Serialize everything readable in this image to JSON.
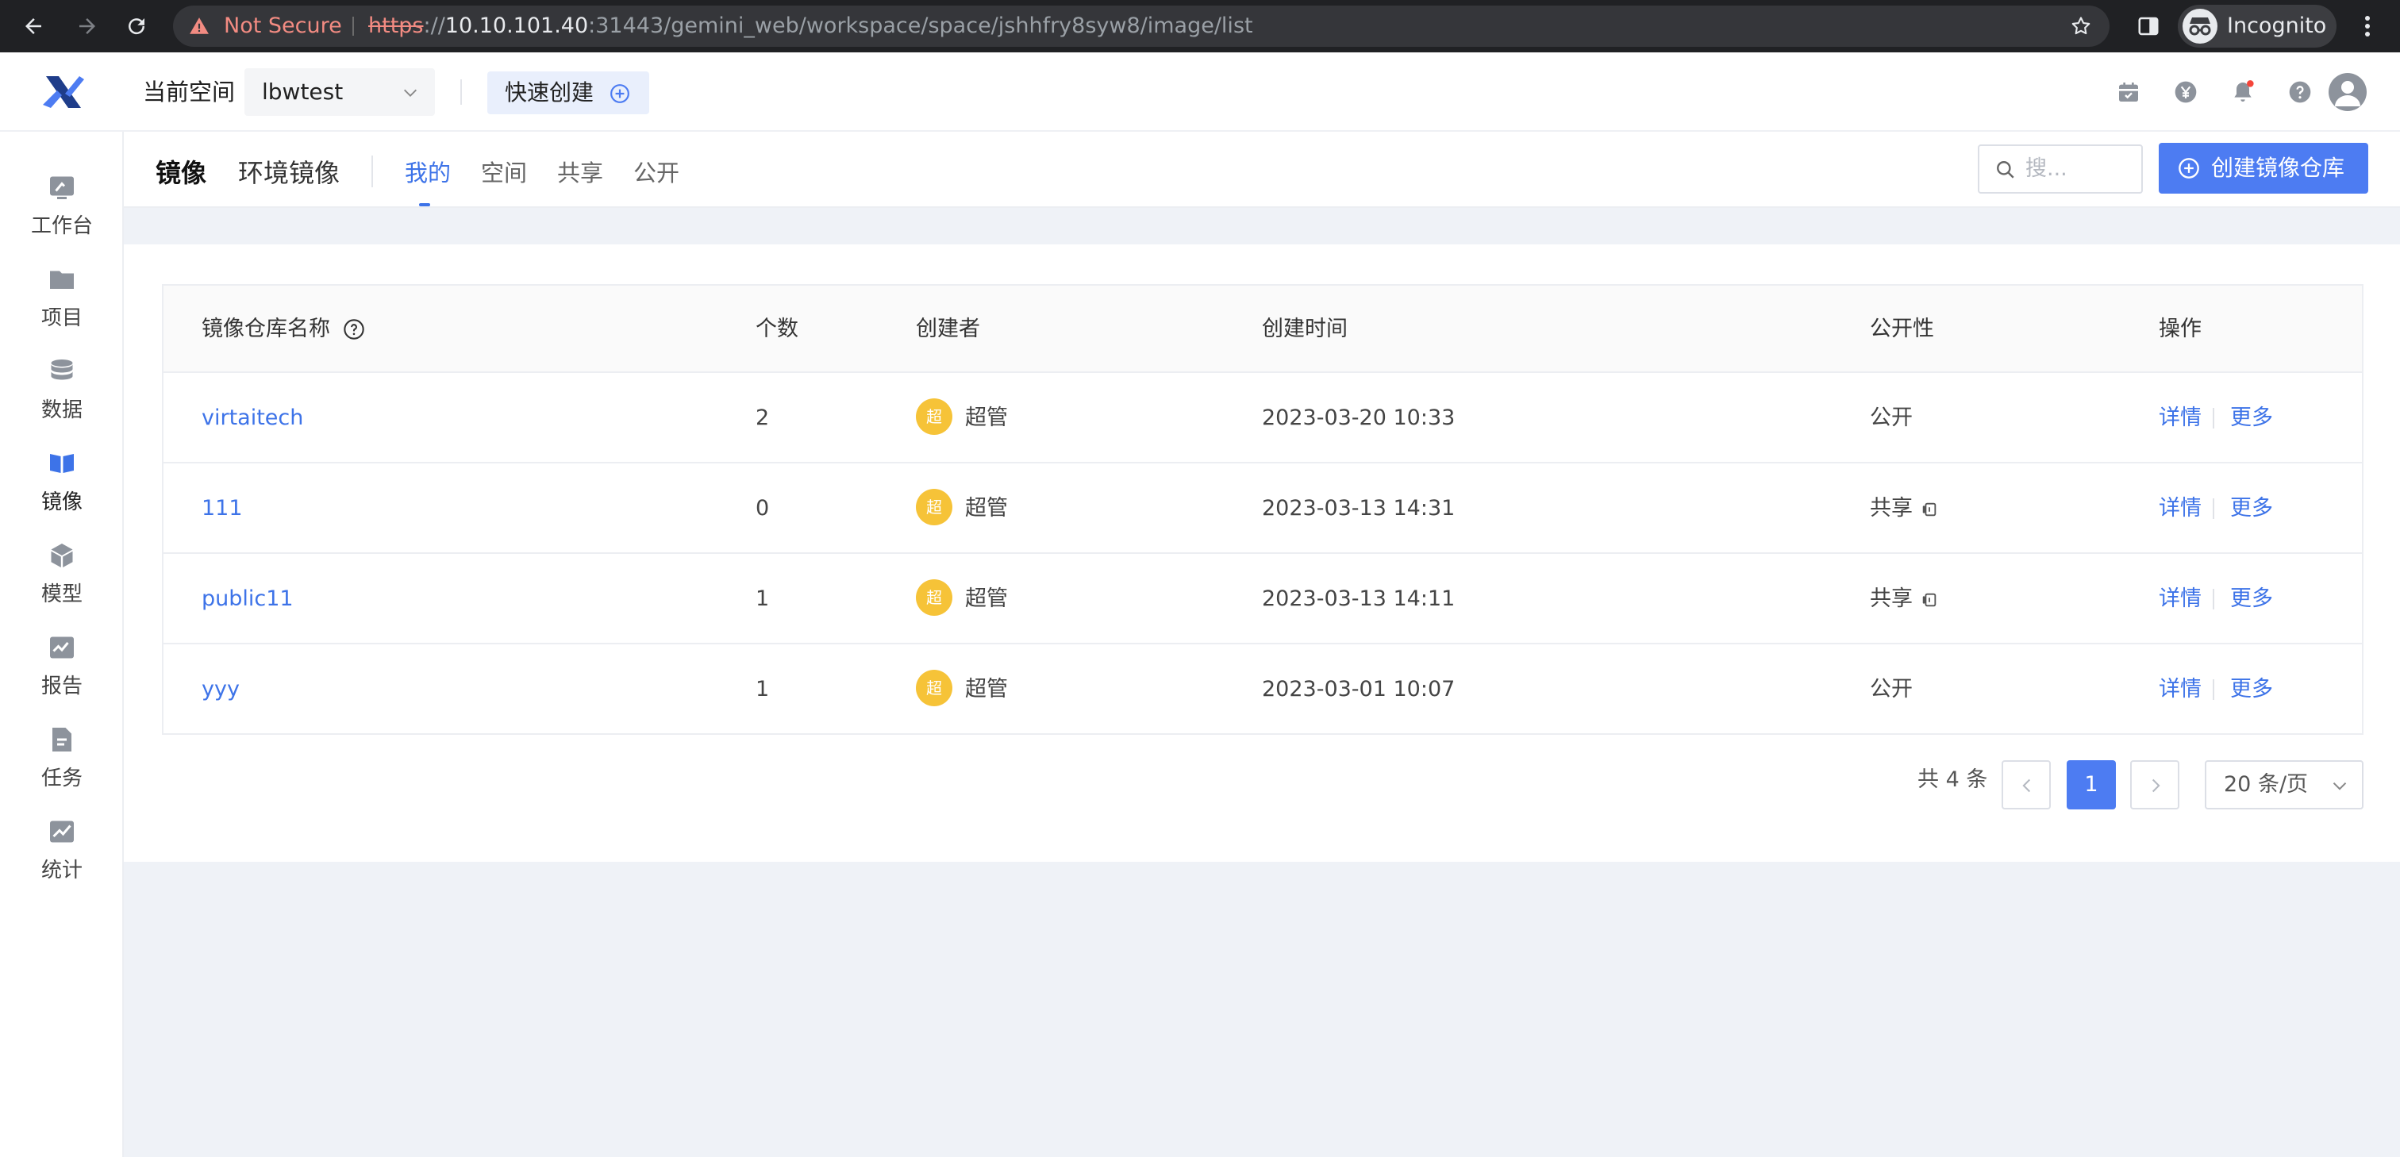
{
  "browser": {
    "security_label": "Not Secure",
    "url_scheme": "https",
    "url_host": "10.10.101.40",
    "url_rest": ":31443/gemini_web/workspace/space/jshhfry8syw8/image/list",
    "profile_label": "Incognito"
  },
  "header": {
    "space_label": "当前空间",
    "space_value": "lbwtest",
    "quick_create_label": "快速创建"
  },
  "sidebar": {
    "items": [
      {
        "label": "工作台",
        "icon": "workbench-icon"
      },
      {
        "label": "项目",
        "icon": "folder-icon"
      },
      {
        "label": "数据",
        "icon": "database-icon"
      },
      {
        "label": "镜像",
        "icon": "image-icon",
        "active": true
      },
      {
        "label": "模型",
        "icon": "cube-icon"
      },
      {
        "label": "报告",
        "icon": "report-icon"
      },
      {
        "label": "任务",
        "icon": "task-icon"
      },
      {
        "label": "统计",
        "icon": "chart-icon"
      }
    ]
  },
  "subnav": {
    "title": "镜像",
    "title2": "环境镜像",
    "tabs": [
      "我的",
      "空间",
      "共享",
      "公开"
    ],
    "active_tab": "我的",
    "search_placeholder": "搜...",
    "create_label": "创建镜像仓库"
  },
  "table": {
    "headers": {
      "name": "镜像仓库名称",
      "count": "个数",
      "creator": "创建者",
      "created": "创建时间",
      "visibility": "公开性",
      "actions": "操作"
    },
    "rows": [
      {
        "name": "virtaitech",
        "count": "2",
        "avatar": "超",
        "creator": "超管",
        "created": "2023-03-20 10:33",
        "visibility": "公开",
        "shared": false,
        "detail": "详情",
        "more": "更多"
      },
      {
        "name": "111",
        "count": "0",
        "avatar": "超",
        "creator": "超管",
        "created": "2023-03-13 14:31",
        "visibility": "共享",
        "shared": true,
        "detail": "详情",
        "more": "更多"
      },
      {
        "name": "public11",
        "count": "1",
        "avatar": "超",
        "creator": "超管",
        "created": "2023-03-13 14:11",
        "visibility": "共享",
        "shared": true,
        "detail": "详情",
        "more": "更多"
      },
      {
        "name": "yyy",
        "count": "1",
        "avatar": "超",
        "creator": "超管",
        "created": "2023-03-01 10:07",
        "visibility": "公开",
        "shared": false,
        "detail": "详情",
        "more": "更多"
      }
    ]
  },
  "pagination": {
    "total_label": "共 4 条",
    "current_page": "1",
    "page_size_label": "20 条/页"
  },
  "colors": {
    "accent": "#4d7cf2",
    "link": "#3d73e8",
    "avatar_bg": "#f6c338",
    "notification_dot": "#f5453a"
  }
}
